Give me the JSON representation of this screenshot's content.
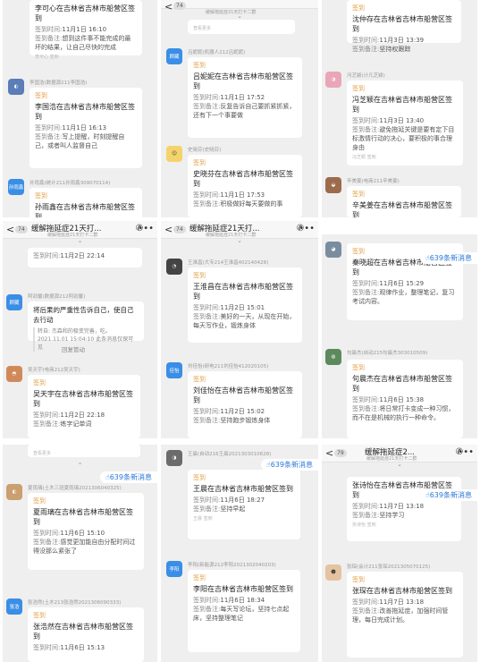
{
  "colors": {
    "accent_orange": "#e2a04a",
    "link_blue": "#2a77d8",
    "panel_bg": "#efefef"
  },
  "common": {
    "checkin_label": "签到",
    "time_label": "签到时间:",
    "note_label": "签到备注:",
    "more_link": "查看更多",
    "new_messages": "639条新消息",
    "chevron": "⌄",
    "back": "<",
    "phone_icon": "✆",
    "more_icon": "•••"
  },
  "panels": {
    "p1": {
      "b0": {
        "title": "李可心在吉林省吉林市船营区签到",
        "time": "11月1日 16:10",
        "note": "想到这件事不能完成的最坏的结果，让自己尽快的完成",
        "foot": "李可心 签到"
      },
      "b1": {
        "name": "李国浩(数据源211李国浩)",
        "title": "李国浩在吉林省吉林市船营区签到",
        "time": "11月1日 16:13",
        "note": "写上提醒，时刻提醒自己，或者叫人监督自己"
      },
      "b2": {
        "avatar": "孙雨鑫",
        "name": "孙雨鑫(统计211孙雨鑫309070114)",
        "title": "孙雨鑫在吉林省吉林市船营区签到"
      }
    },
    "p2": {
      "topbar": {
        "badge": "74",
        "title": "缓解拖延症",
        "sub": "缓解拖延症21天打卡二群"
      },
      "b0": {
        "avatar": "顾藏",
        "name": "吕妮妮(机器人212吕妮妮)",
        "title": "吕妮妮在吉林省吉林市船营区签到",
        "time": "11月1日 17:52",
        "note": "反复告诉自己要抓紧抓紧，还有下一个事要做"
      },
      "b1": {
        "name": "史晓芬(史晓芬)",
        "title": "史晓芬在吉林省吉林市船营区签到",
        "time": "11月1日 17:53",
        "note": "积极做好每天要做的事"
      }
    },
    "p3": {
      "b0": {
        "title": "沈仲存在吉林省吉林市船营区签到",
        "time": "11月3日 13:39",
        "note": "坚持权跟踪"
      },
      "b1": {
        "name": "冯芝颖(计凡芝颖)",
        "title": "冯芝颖在吉林省吉林市船营区签到",
        "time": "11月3日 13:40",
        "note": "避免拖延关键是要有定下目标激情行动的决心，要积极的事合理身由",
        "foot": "冯芝颖 签到"
      },
      "b2": {
        "name": "辛美姜(电商211辛美姜)",
        "title": "辛美姜在吉林省吉林市船营区签到"
      }
    },
    "p4": {
      "topbar": {
        "badge": "74",
        "title": "缓解拖延症21天打...",
        "sub": "缓解拖延症21天打卡二群"
      },
      "b0": {
        "time": "11月2日 22:14"
      },
      "sys": {
        "avatar": "顾藏",
        "name": "阿劲馨(数据源212阿劲馨)",
        "text": "将后果的严重性告诉自己，使自己去行动",
        "quote": "转自: 杰森和的极变完善，吃。2021.11.01 15:04:10 此条消息仅保可见"
      },
      "recall": "回复管动",
      "b1": {
        "name": "吴天宇(电商212吴天宇)",
        "title": "吴天宇在吉林省吉林市船营区签到",
        "time": "11月2日 22:18",
        "note": "练字记单词"
      }
    },
    "p5": {
      "topbar": {
        "badge": "74",
        "title": "缓解拖延症21天打...",
        "sub": "缓解拖延症21天打卡二群"
      },
      "b0": {
        "name": "王淮昌(大专214王淮昌402140428)",
        "title": "王淮昌在吉林省吉林市船营区签到",
        "time": "11月2日 15:01",
        "note": "美好的一天，从现在开始，每天写作业，锻炼身体"
      },
      "b1": {
        "avatar": "佳怡",
        "name": "刘佳怡(研电211刘佳怡412020105)",
        "title": "刘佳怡在吉林省吉林市船营区签到",
        "time": "11月2日 15:02",
        "note": "坚持跑步锻炼身体"
      }
    },
    "p6": {
      "b0": {
        "title": "秦晓超在吉林省吉林市船营区签到",
        "time": "11月6日 15:29",
        "note": "观律作业，整理笔记，复习考试内容。"
      },
      "b1": {
        "name": "句晨杰(自动215句晨杰303010509)",
        "title": "句晨杰在吉林省吉林市船营区签到",
        "time": "11月6日 15:38",
        "note": "将日常打卡变成一种习惯，而不在是机械的执行一种命令。"
      }
    },
    "p7": {
      "b0": {
        "name": "夏雨璃(土木三班夏雨璃2021306040325)",
        "title": "夏雨璃在吉林省吉林市船营区签到",
        "time": "11月6日 15:10",
        "note": "感觉更加能自由分配时间过得没那么紧张了"
      },
      "b1": {
        "avatar": "张浩",
        "name": "张浩然(土木213张浩然2021306090333)",
        "title": "张浩然在吉林省吉林市船营区签到",
        "time": "11月6日 15:13"
      }
    },
    "p8": {
      "b0": {
        "name": "王晨(自动216王晨2021303010628)",
        "title": "王晨在吉林省吉林市船营区签到",
        "time": "11月6日 18:27",
        "note": "坚持早起",
        "foot": "王晨 签到"
      },
      "b1": {
        "avatar": "李阳",
        "name": "李阳(新能源212李阳2021302040203)",
        "title": "李阳在吉林省吉林市船营区签到",
        "time": "11月6日 18:34",
        "note": "每天写论坛，坚持七点起床，坚持整理笔记"
      }
    },
    "p9": {
      "topbar": {
        "badge": "79",
        "title": "缓解拖延症2...",
        "sub": "缓解拖延症21天打卡二群"
      },
      "b0": {
        "title": "张诗怡在吉林省吉林市船营区签到",
        "time": "11月7日 13:18",
        "note": "坚持学习",
        "foot": "张诗怡 签到"
      },
      "b1": {
        "name": "张琛(会计211张琛2021305070125)",
        "title": "张琛在吉林省吉林市船营区签到",
        "time": "11月7日 13:18",
        "note": "改善拖延症，加强时间管理，每日完成计划。"
      }
    }
  }
}
